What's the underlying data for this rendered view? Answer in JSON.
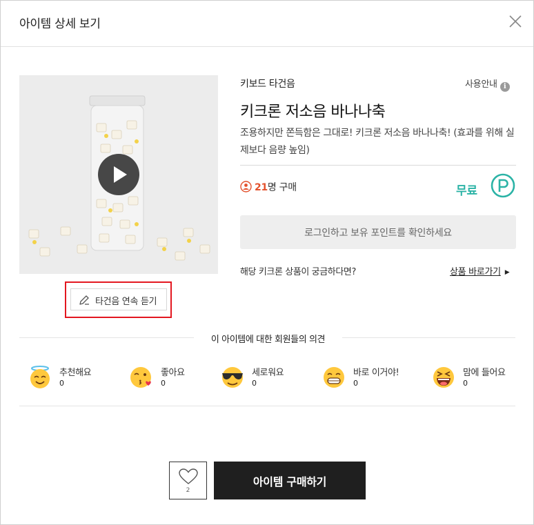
{
  "header": {
    "title": "아이템 상세 보기"
  },
  "product": {
    "category": "키보드 타건음",
    "usage_guide": "사용안내",
    "title": "키크론 저소음 바나나축",
    "description": "조용하지만 쫀득함은 그대로! 키크론 저소음 바나나축! (효과를 위해 실제보다 음량 높임)",
    "purchase_count": "21",
    "purchase_suffix": "명 구매",
    "price": "무료",
    "listen_button": "타건음 연속 듣기"
  },
  "login_bar": {
    "label": "로그인하고 보유 포인트를 확인하세요"
  },
  "product_link": {
    "question": "해당 키크론 상품이 궁금하다면?",
    "link_label": "상품 바로가기"
  },
  "opinions": {
    "title": "이 아이템에 대한 회원들의 의견",
    "reactions": [
      {
        "label": "추천해요",
        "count": "0",
        "icon": "angel-emoji-icon"
      },
      {
        "label": "좋아요",
        "count": "0",
        "icon": "kiss-emoji-icon"
      },
      {
        "label": "세로워요",
        "count": "0",
        "icon": "sunglasses-emoji-icon"
      },
      {
        "label": "바로 이거야!",
        "count": "0",
        "icon": "grin-emoji-icon"
      },
      {
        "label": "맘에 들어요",
        "count": "0",
        "icon": "laugh-emoji-icon"
      }
    ]
  },
  "footer": {
    "like_count": "2",
    "buy_label": "아이템 구매하기"
  },
  "colors": {
    "accent_teal": "#2bb3a6",
    "highlight_red": "#e3161f",
    "count_orange": "#e3512c",
    "buy_button": "#1f1f1f"
  }
}
